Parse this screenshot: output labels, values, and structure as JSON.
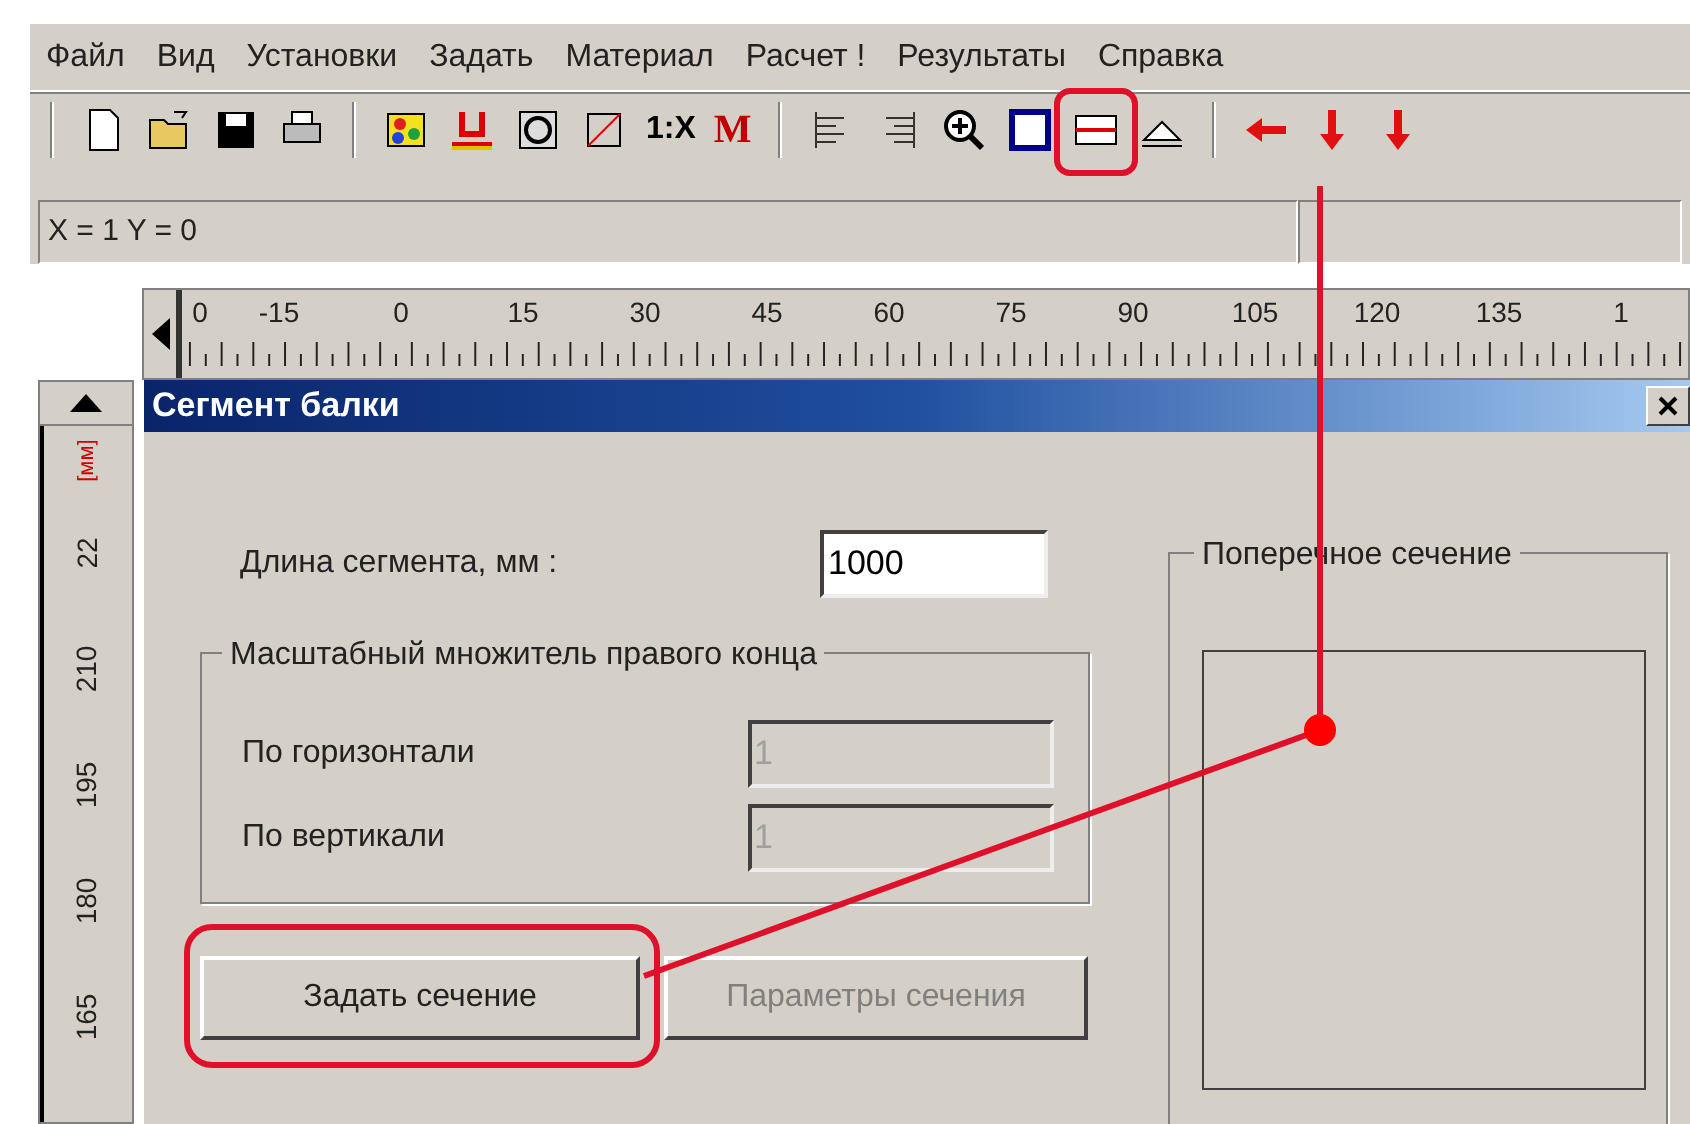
{
  "menu": [
    "Файл",
    "Вид",
    "Установки",
    "Задать",
    "Материал",
    "Расчет !",
    "Результаты",
    "Справка"
  ],
  "toolbar": {
    "scale_label": "1:X",
    "material_label": "M",
    "section_tool": {
      "highlighted": true
    }
  },
  "coordinates": "X = 1  Y = 0",
  "ruler_h": [
    "0",
    "-15",
    "0",
    "15",
    "30",
    "45",
    "60",
    "75",
    "90",
    "105",
    "120",
    "135",
    "1"
  ],
  "ruler_v": {
    "unit": "[мм]",
    "labels": [
      "22",
      "210",
      "195",
      "180",
      "165"
    ]
  },
  "dialog": {
    "title": "Сегмент балки",
    "length": {
      "label": "Длина сегмента, мм :",
      "value": "1000"
    },
    "scale_group": {
      "legend": "Масштабный множитель правого конца",
      "rows": [
        {
          "label": "По горизонтали",
          "value": "1",
          "disabled": true
        },
        {
          "label": "По вертикали",
          "value": "1",
          "disabled": true
        }
      ]
    },
    "buttons": [
      {
        "label": "Задать сечение",
        "disabled": false,
        "highlighted": true
      },
      {
        "label": "Параметры сечения",
        "disabled": true,
        "highlighted": false
      }
    ],
    "section_group": {
      "legend": "Поперечное сечение"
    }
  }
}
